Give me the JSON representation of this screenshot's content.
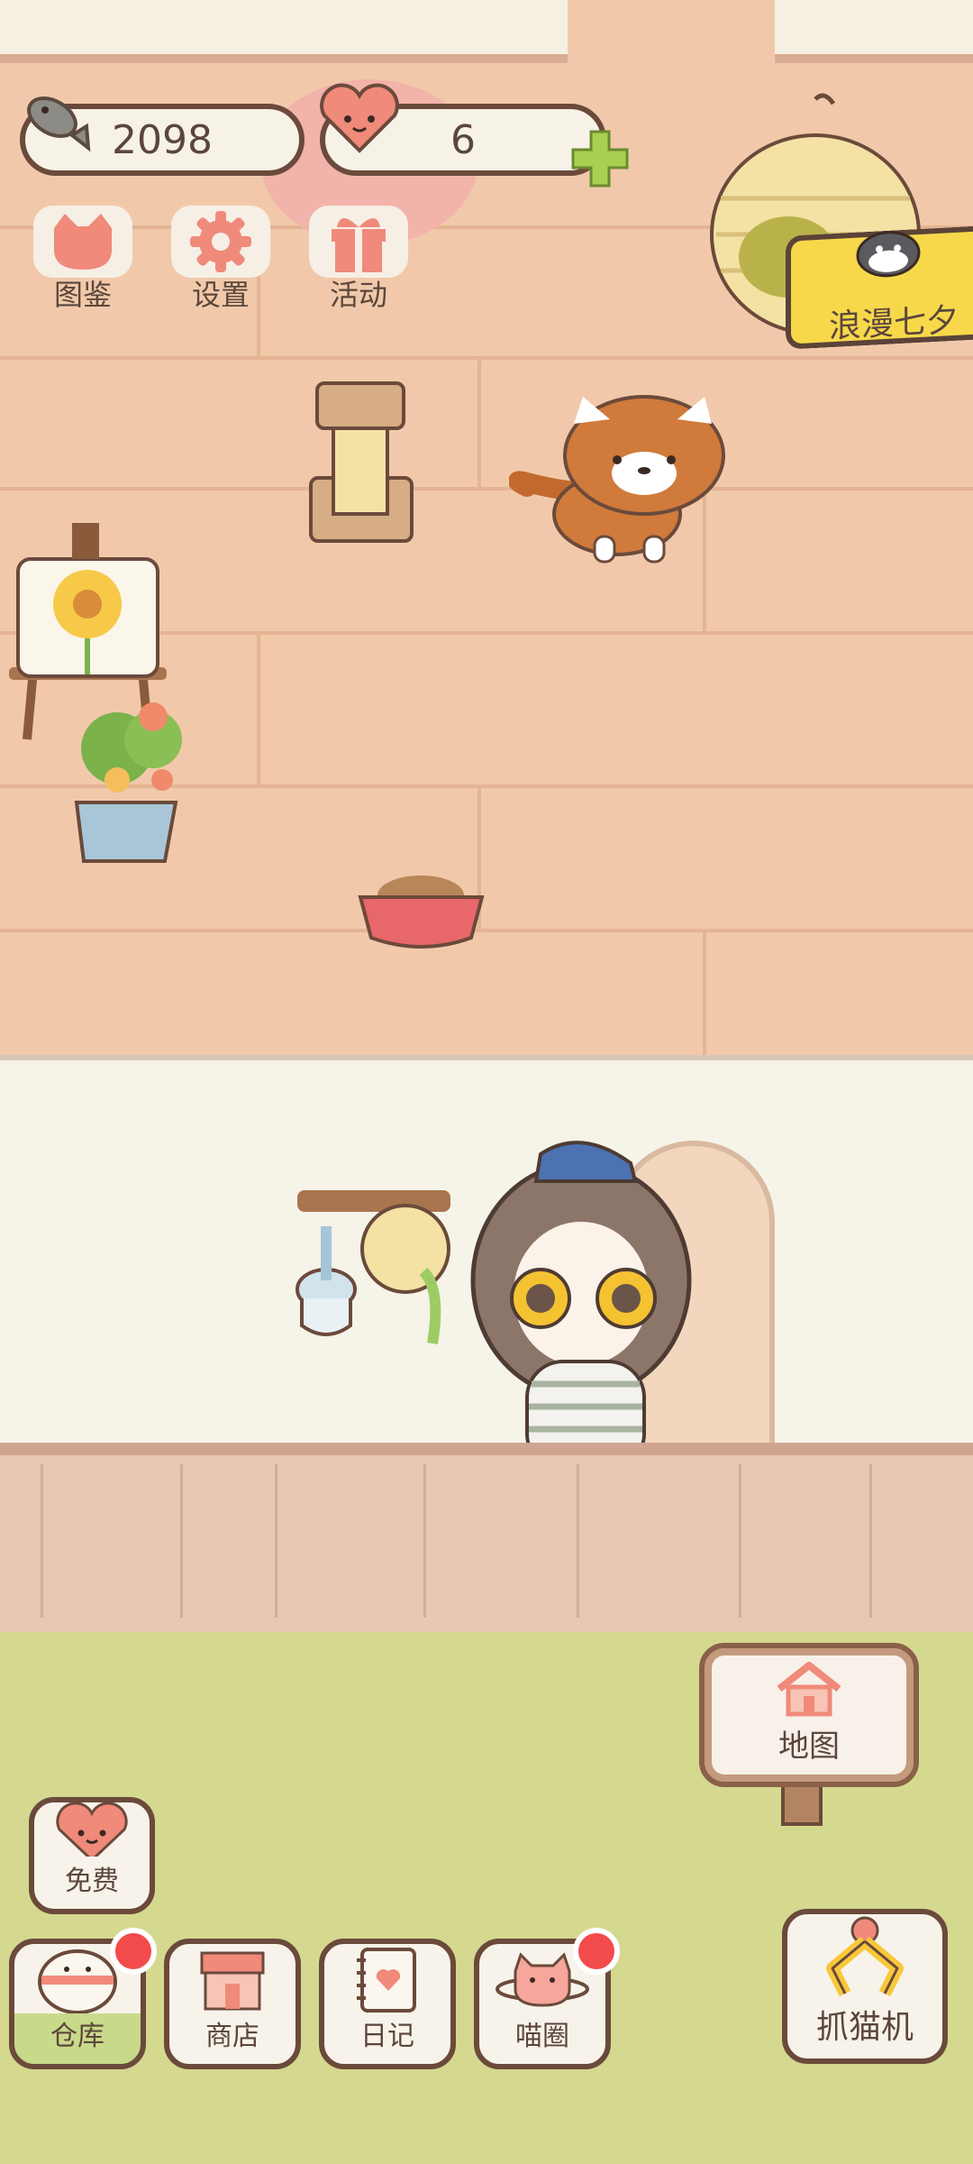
{
  "hud": {
    "fish_count": "2098",
    "heart_count": "6",
    "fish_icon": "fish-icon",
    "heart_icon": "heart-face-icon",
    "plus_icon": "plus-icon"
  },
  "top_menu": [
    {
      "label": "图鉴",
      "icon": "cat-head-icon"
    },
    {
      "label": "设置",
      "icon": "gear-icon"
    },
    {
      "label": "活动",
      "icon": "gift-icon"
    }
  ],
  "event_banner": {
    "label": "浪漫七夕",
    "icon": "penguin-icon"
  },
  "map_sign": {
    "label": "地图",
    "icon": "house-icon"
  },
  "free_button": {
    "label": "免费",
    "icon": "heart-face-icon"
  },
  "bottom_bar": [
    {
      "label": "仓库",
      "icon": "storage-icon",
      "has_dot": true
    },
    {
      "label": "商店",
      "icon": "shop-icon",
      "has_dot": false
    },
    {
      "label": "日记",
      "icon": "diary-icon",
      "has_dot": false
    },
    {
      "label": "喵圈",
      "icon": "cat-planet-icon",
      "has_dot": true
    }
  ],
  "claw_button": {
    "label": "抓猫机",
    "icon": "claw-icon"
  },
  "colors": {
    "accent_red": "#f34b4b",
    "icon_pink": "#f08a7a",
    "plus_green": "#a9cf52",
    "banner_yellow": "#f7d84a",
    "outline": "#6b4a3b"
  }
}
